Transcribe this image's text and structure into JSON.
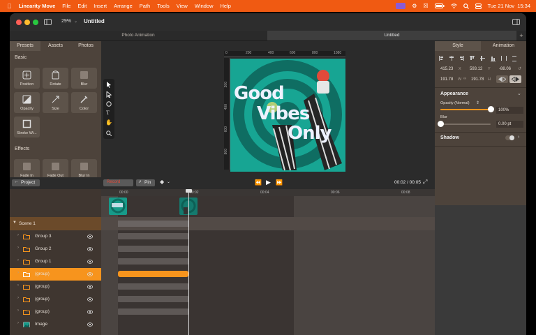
{
  "menubar": {
    "app_name": "Linearity Move",
    "items": [
      "File",
      "Edit",
      "Insert",
      "Arrange",
      "Path",
      "Tools",
      "View",
      "Window",
      "Help"
    ],
    "datetime": "Tue 21 Nov  15:34"
  },
  "window": {
    "zoom": "29%",
    "title": "Untitled",
    "tabs": [
      "Photo Animation",
      "Untitled"
    ],
    "add_tab_icon": "+"
  },
  "left_panel": {
    "tabs": [
      "Presets",
      "Assets",
      "Photos"
    ],
    "basic_label": "Basic",
    "basic_presets": [
      "Position",
      "Rotate",
      "Blur",
      "Opacity",
      "Size",
      "Color",
      "Stroke Wi..."
    ],
    "effects_label": "Effects",
    "effects_presets": [
      "Fade In",
      "Fade Out",
      "Blur In"
    ]
  },
  "canvas": {
    "ruler_labels": [
      "0",
      "200",
      "400",
      "600",
      "800",
      "1080"
    ],
    "vruler_labels": [
      "200",
      "400",
      "600",
      "800"
    ],
    "artwork_text": [
      "Good",
      "Vibes",
      "Only"
    ]
  },
  "right_panel": {
    "tabs": [
      "Style",
      "Animation"
    ],
    "x": "415.23",
    "x_unit": "X",
    "y": "593.12",
    "y_unit": "Y",
    "rotation": "-88.06",
    "width": "191.78",
    "w_unit": "W",
    "height": "191.78",
    "h_unit": "H",
    "appearance_label": "Appearance",
    "opacity_label": "Opacity (Normal)",
    "opacity_value": "100%",
    "opacity_fraction": 1.0,
    "blur_label": "Blur",
    "blur_value": "0.00 pt",
    "blur_fraction": 0.0,
    "shadow_label": "Shadow"
  },
  "timeline": {
    "back_label": "Project",
    "record_label": "Record",
    "pin_label": "Pin",
    "time": "00:02 / 00:05",
    "ruler_labels": [
      "00:00",
      "00:02",
      "00:04",
      "00:06",
      "00:08"
    ],
    "scene_label": "Scene 1",
    "layers": [
      {
        "name": "Group 3",
        "selected": false,
        "type": "folder"
      },
      {
        "name": "Group 2",
        "selected": false,
        "type": "folder"
      },
      {
        "name": "Group 1",
        "selected": false,
        "type": "folder"
      },
      {
        "name": "(group)",
        "selected": true,
        "type": "folder"
      },
      {
        "name": "(group)",
        "selected": false,
        "type": "folder"
      },
      {
        "name": "(group)",
        "selected": false,
        "type": "folder"
      },
      {
        "name": "(group)",
        "selected": false,
        "type": "folder"
      },
      {
        "name": "Image",
        "selected": false,
        "type": "image"
      }
    ]
  },
  "colors": {
    "accent": "#f05a12",
    "selection": "#f7941d",
    "artwork_teal": "#1fb8a4"
  }
}
